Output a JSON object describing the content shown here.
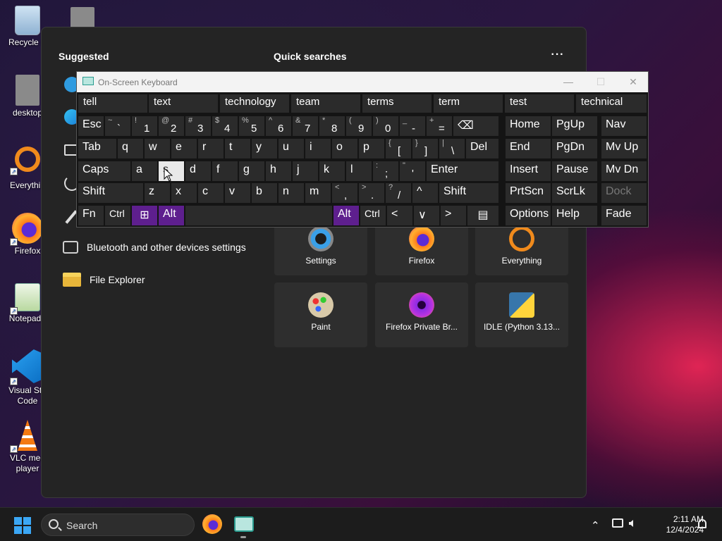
{
  "desktop": {
    "icons": [
      {
        "label": "Recycle B"
      },
      {
        "label": "desktop"
      },
      {
        "label": "Everythin"
      },
      {
        "label": "Firefox"
      },
      {
        "label": "Notepad+"
      },
      {
        "label": "Visual Stu Code"
      },
      {
        "label": "VLC med player"
      }
    ]
  },
  "start_menu": {
    "suggested_title": "Suggested",
    "quick_searches_title": "Quick searches",
    "more_label": "···",
    "suggested_items": [
      {
        "label": "Bluetooth and other devices settings"
      },
      {
        "label": "File Explorer"
      }
    ],
    "tiles": [
      {
        "label": "Settings"
      },
      {
        "label": "Firefox"
      },
      {
        "label": "Everything"
      },
      {
        "label": "Paint"
      },
      {
        "label": "Firefox Private Br..."
      },
      {
        "label": "IDLE (Python 3.13..."
      }
    ]
  },
  "osk": {
    "title": "On-Screen Keyboard",
    "min_label": "—",
    "max_label": "☐",
    "close_label": "✕",
    "predictions": [
      "tell",
      "text",
      "technology",
      "team",
      "terms",
      "term",
      "test",
      "technical"
    ],
    "row1": [
      {
        "label": "Esc"
      },
      {
        "shift": "~",
        "main": "`"
      },
      {
        "shift": "!",
        "main": "1"
      },
      {
        "shift": "@",
        "main": "2"
      },
      {
        "shift": "#",
        "main": "3"
      },
      {
        "shift": "$",
        "main": "4"
      },
      {
        "shift": "%",
        "main": "5"
      },
      {
        "shift": "^",
        "main": "6"
      },
      {
        "shift": "&",
        "main": "7"
      },
      {
        "shift": "*",
        "main": "8"
      },
      {
        "shift": "(",
        "main": "9"
      },
      {
        "shift": ")",
        "main": "0"
      },
      {
        "shift": "_",
        "main": "-"
      },
      {
        "shift": "+",
        "main": "="
      },
      {
        "label": "⌫"
      },
      {
        "label": "Home"
      },
      {
        "label": "PgUp"
      },
      {
        "label": "Nav"
      }
    ],
    "row2": [
      "Tab",
      "q",
      "w",
      "e",
      "r",
      "t",
      "y",
      "u",
      "i",
      "o",
      "p"
    ],
    "row2_sym": [
      {
        "shift": "{",
        "main": "["
      },
      {
        "shift": "}",
        "main": "]"
      },
      {
        "shift": "|",
        "main": "\\"
      }
    ],
    "row2_right": [
      "Del",
      "End",
      "PgDn",
      "Mv Up"
    ],
    "row3": [
      "Caps",
      "a",
      "s",
      "d",
      "f",
      "g",
      "h",
      "j",
      "k",
      "l"
    ],
    "row3_sym": [
      {
        "shift": ":",
        "main": ";"
      },
      {
        "shift": "\"",
        "main": "'"
      }
    ],
    "row3_right": [
      "Enter",
      "Insert",
      "Pause",
      "Mv Dn"
    ],
    "row4": [
      "Shift",
      "z",
      "x",
      "c",
      "v",
      "b",
      "n",
      "m"
    ],
    "row4_sym": [
      {
        "shift": "<",
        "main": ","
      },
      {
        "shift": ">",
        "main": "."
      },
      {
        "shift": "?",
        "main": "/"
      }
    ],
    "row4_right": [
      "^",
      "Shift",
      "PrtScn",
      "ScrLk",
      "Dock"
    ],
    "row5": [
      "Fn",
      "Ctrl",
      "⊞",
      "Alt",
      "Alt",
      "Ctrl",
      "<",
      "∨",
      ">",
      "▤",
      "Options",
      "Help",
      "Fade"
    ]
  },
  "taskbar": {
    "search_placeholder": "Search",
    "chevron": "⌃",
    "time": "2:11 AM",
    "date": "12/4/2024"
  },
  "colors": {
    "accent_purple": "#5e1f8e",
    "windows_blue": "#3ba7f5"
  }
}
